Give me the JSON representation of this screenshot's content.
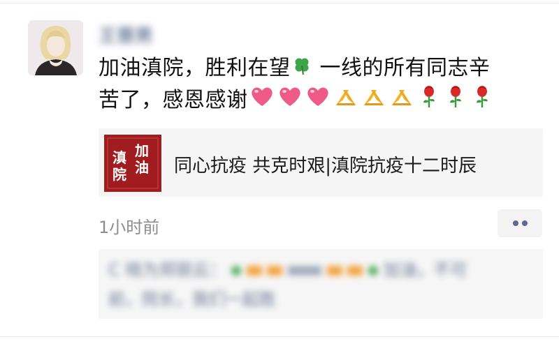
{
  "post": {
    "author": "王晋男",
    "text_line1": "加油滇院，胜利在望",
    "text_line1b": "一线的所有同志辛",
    "text_line2": "苦了，感恩感谢",
    "emojis_line1": [
      "four-leaf-clover"
    ],
    "emojis_line2": [
      "heart",
      "heart",
      "heart",
      "folded-hands",
      "folded-hands",
      "folded-hands",
      "rose",
      "rose",
      "rose"
    ],
    "time": "1小时前"
  },
  "link_card": {
    "thumb_chars": [
      "滇",
      "加",
      "院",
      "油"
    ],
    "title": "同心抗疫 共克时艰|滇院抗疫十二时辰"
  },
  "comment": {
    "line1": "C 晓为郑丽云：",
    "line1_tail": "加油，不可",
    "line2": "前，院长，我们一起胜"
  },
  "colors": {
    "name_blue": "#5a6b8c",
    "link_red": "#a11c1f",
    "comment_bg": "#f6f6f6"
  }
}
